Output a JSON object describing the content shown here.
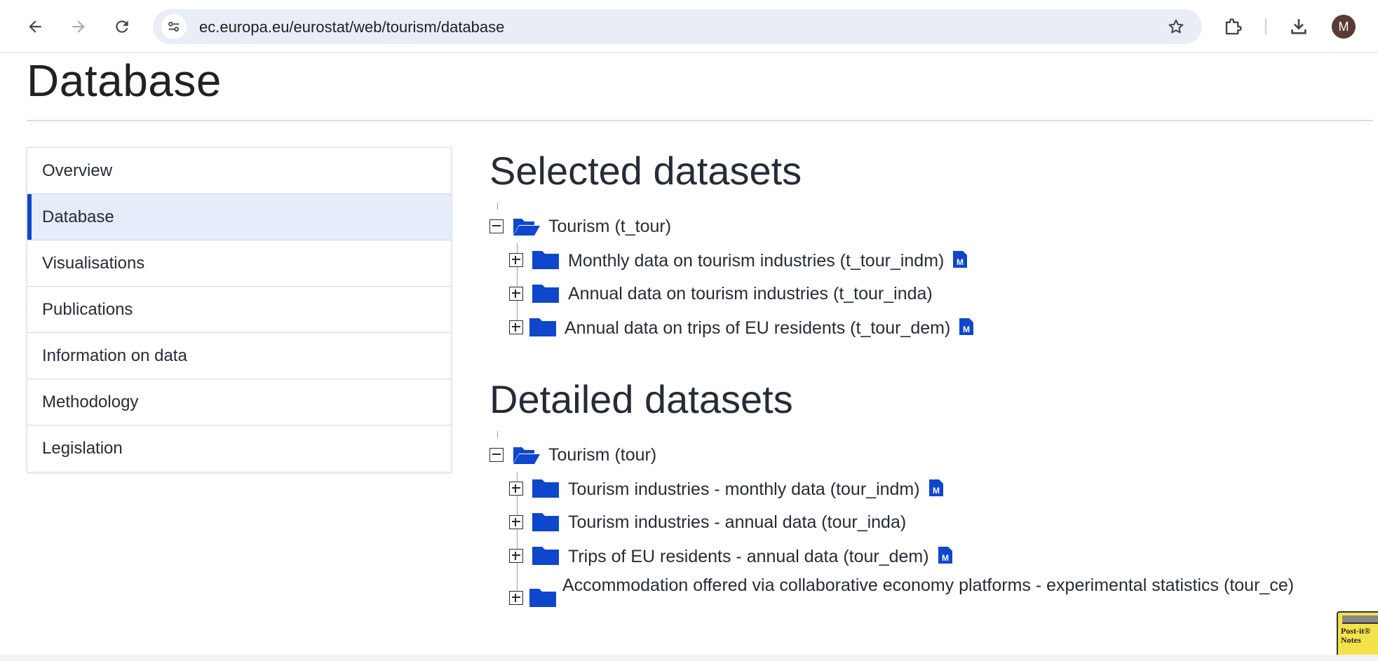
{
  "browser": {
    "url": "ec.europa.eu/eurostat/web/tourism/database",
    "profile_initial": "M",
    "icons": [
      "back-arrow-icon",
      "forward-arrow-icon",
      "reload-icon",
      "site-settings-icon",
      "bookmark-star-icon",
      "extensions-icon",
      "download-icon"
    ]
  },
  "page": {
    "title": "Database"
  },
  "sidebar": {
    "items": [
      {
        "label": "Overview"
      },
      {
        "label": "Database",
        "active": true
      },
      {
        "label": "Visualisations"
      },
      {
        "label": "Publications"
      },
      {
        "label": "Information on data"
      },
      {
        "label": "Methodology"
      },
      {
        "label": "Legislation"
      }
    ]
  },
  "selected": {
    "heading": "Selected datasets",
    "root": "Tourism (t_tour)",
    "children": [
      {
        "label": "Monthly data on tourism industries (t_tour_indm)",
        "metadata": true
      },
      {
        "label": "Annual data on tourism industries (t_tour_inda)",
        "metadata": false
      },
      {
        "label": "Annual data on trips of EU residents (t_tour_dem)",
        "metadata": true
      }
    ]
  },
  "detailed": {
    "heading": "Detailed datasets",
    "root": "Tourism (tour)",
    "children": [
      {
        "label": "Tourism industries - monthly data (tour_indm)",
        "metadata": true
      },
      {
        "label": "Tourism industries - annual data (tour_inda)",
        "metadata": false
      },
      {
        "label": "Trips of EU residents - annual data (tour_dem)",
        "metadata": true
      },
      {
        "label": "Accommodation offered via collaborative economy platforms - experimental statistics (tour_ce)",
        "metadata": false
      }
    ]
  },
  "postit": {
    "text": "Post-it® Notes"
  },
  "colors": {
    "accent": "#0e47cb",
    "folder": "#0e47cb",
    "active_bg": "#e6ecf9"
  }
}
